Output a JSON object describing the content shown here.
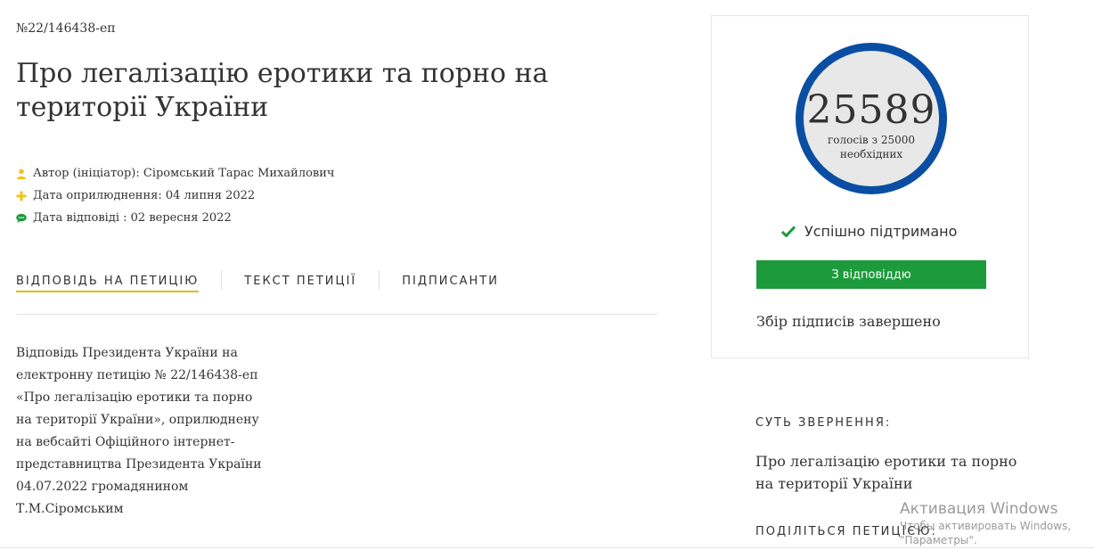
{
  "petition": {
    "number": "№22/146438-еп",
    "title": "Про легалізацію еротики та порно на території України",
    "meta": {
      "author": "Автор (ініціатор): Сіромський Тарас Михайлович",
      "published": "Дата оприлюднення: 04 липня 2022",
      "answered": "Дата відповіді : 02 вересня 2022"
    }
  },
  "tabs": [
    {
      "label": "ВІДПОВІДЬ НА ПЕТИЦІЮ",
      "active": true
    },
    {
      "label": "ТЕКСТ ПЕТИЦІЇ",
      "active": false
    },
    {
      "label": "ПІДПИСАНТИ",
      "active": false
    }
  ],
  "answer_text": "Відповідь Президента України на\nелектронну петицію № 22/146438-еп\n«Про легалізацію еротики та порно\nна території України», оприлюднену\nна вебсайті Офіційного інтернет-\nпредставництва Президента України\n04.07.2022 громадянином\nТ.М.Сіромським",
  "votes": {
    "count": "25589",
    "caption": "голосів з 25000\nнеобхідних",
    "status": "Успішно підтримано",
    "button_label": "З відповіддю",
    "collection_status": "Збір підписів завершено"
  },
  "sidebar": {
    "essence_heading": "СУТЬ ЗВЕРНЕННЯ:",
    "essence_text": "Про легалізацію еротики та порно на території України",
    "share_heading": "ПОДІЛІТЬСЯ ПЕТИЦІЄЮ:"
  },
  "watermark": {
    "title": "Активация Windows",
    "subtitle": "Чтобы активировать Windows,\n\"Параметры\"."
  },
  "colors": {
    "accent_yellow": "#e4b80e",
    "circle_blue": "#0a4ea3",
    "success_green": "#1c9a3c"
  },
  "icons": {
    "author": "user-icon",
    "published": "plus-icon",
    "answered": "comment-icon",
    "status": "check-icon"
  }
}
